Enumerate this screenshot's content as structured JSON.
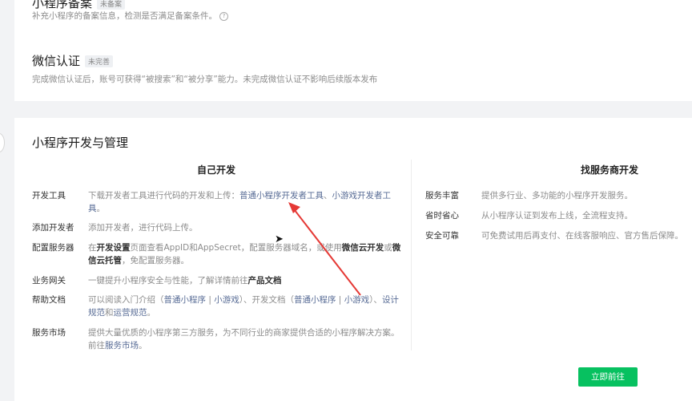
{
  "top_card": {
    "filing": {
      "title": "小程序备案",
      "badge": "未备案",
      "desc": "补充小程序的备案信息，检测是否满足备案条件。"
    },
    "wechat_cert": {
      "title": "微信认证",
      "badge": "未完善",
      "desc": "完成微信认证后，账号可获得“被搜索”和“被分享”能力。未完成微信认证不影响后续版本发布"
    }
  },
  "main": {
    "title": "小程序开发与管理",
    "self_dev": {
      "title": "自己开发",
      "rows": {
        "tools": {
          "label": "开发工具",
          "text": "下载开发者工具进行代码的开发和上传：",
          "link1": "普通小程序开发者工具",
          "sep": "、",
          "link2": "小游戏开发者工具",
          "end": "。"
        },
        "add_dev": {
          "label": "添加开发者",
          "text": "添加开发者，进行代码上传。"
        },
        "config": {
          "label": "配置服务器",
          "p1": "在",
          "b1": "开发设置",
          "p2": "页面查看AppID和AppSecret，配置服务器域名，或使用",
          "b2": "微信云开发",
          "p3": "或",
          "b3": "微信云托管",
          "p4": "，免配置服务器。"
        },
        "gateway": {
          "label": "业务网关",
          "text": "一键提升小程序安全与性能，了解详情前往",
          "b1": "产品文档"
        },
        "help": {
          "label": "帮助文档",
          "p1": "可以阅读入门介绍（",
          "l1": "普通小程序",
          "bar1": " | ",
          "l2": "小游戏",
          "p2": "）、开发文档（",
          "l3": "普通小程序",
          "bar2": " | ",
          "l4": "小游戏",
          "p3": "）、",
          "l5": "设计规范",
          "and": "和",
          "l6": "运营规范",
          "end": "。"
        },
        "market": {
          "label": "服务市场",
          "text": "提供大量优质的小程序第三方服务，为不同行业的商家提供合适的小程序解决方案。前往",
          "l1": "服务市场",
          "end": "。"
        }
      }
    },
    "provider": {
      "title": "找服务商开发",
      "rows": [
        {
          "label": "服务丰富",
          "text": "提供多行业、多功能的小程序开发服务。"
        },
        {
          "label": "省时省心",
          "text": "从小程序认证到发布上线，全流程支持。"
        },
        {
          "label": "安全可靠",
          "text": "可免费试用后再支付、在线客服响应、官方售后保障。"
        }
      ],
      "button": "立即前往"
    }
  },
  "colors": {
    "accent": "#07c160",
    "link": "#576b95",
    "arrow": "#e53935"
  }
}
